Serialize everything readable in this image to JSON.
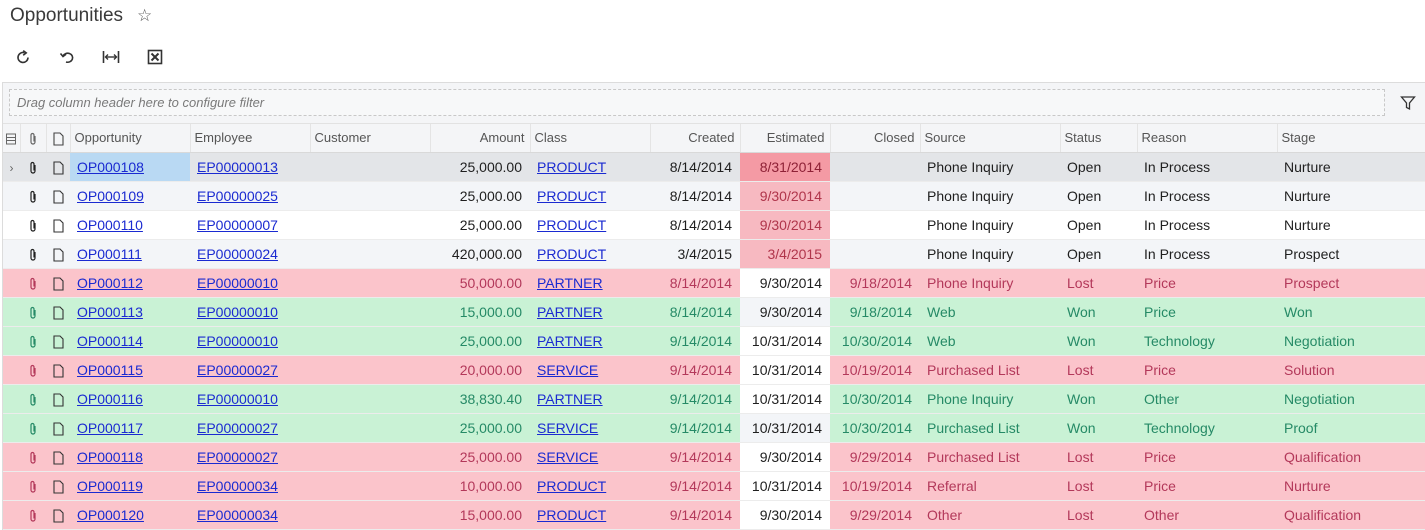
{
  "page": {
    "title": "Opportunities",
    "favorite_icon": "star-outline-icon"
  },
  "toolbar": {
    "buttons": [
      {
        "name": "refresh-button",
        "icon": "refresh-icon"
      },
      {
        "name": "undo-button",
        "icon": "undo-icon"
      },
      {
        "name": "fit-columns-button",
        "icon": "fit-columns-icon"
      },
      {
        "name": "export-excel-button",
        "icon": "excel-icon"
      }
    ]
  },
  "filter": {
    "placeholder": "Drag column header here to configure filter",
    "icon": "filter-funnel-icon"
  },
  "columns": {
    "opportunity": "Opportunity",
    "employee": "Employee",
    "customer": "Customer",
    "amount": "Amount",
    "class": "Class",
    "created": "Created",
    "estimated": "Estimated",
    "closed": "Closed",
    "source": "Source",
    "status": "Status",
    "reason": "Reason",
    "stage": "Stage"
  },
  "colors": {
    "lost_row": "#fbc4cb",
    "won_row": "#c9f2d5",
    "overdue_estimate": "#f7b9c1",
    "selected_cell": "#b9d9f3",
    "link": "#1a2ad1"
  },
  "rows": [
    {
      "opportunity": "OP000108",
      "employee": "EP00000013",
      "customer": "",
      "amount": "25,000.00",
      "class": "PRODUCT",
      "created": "8/14/2014",
      "estimated": "8/31/2014",
      "closed": "",
      "source": "Phone Inquiry",
      "status": "Open",
      "reason": "In Process",
      "stage": "Nurture"
    },
    {
      "opportunity": "OP000109",
      "employee": "EP00000025",
      "customer": "",
      "amount": "25,000.00",
      "class": "PRODUCT",
      "created": "8/14/2014",
      "estimated": "9/30/2014",
      "closed": "",
      "source": "Phone Inquiry",
      "status": "Open",
      "reason": "In Process",
      "stage": "Nurture"
    },
    {
      "opportunity": "OP000110",
      "employee": "EP00000007",
      "customer": "",
      "amount": "25,000.00",
      "class": "PRODUCT",
      "created": "8/14/2014",
      "estimated": "9/30/2014",
      "closed": "",
      "source": "Phone Inquiry",
      "status": "Open",
      "reason": "In Process",
      "stage": "Nurture"
    },
    {
      "opportunity": "OP000111",
      "employee": "EP00000024",
      "customer": "",
      "amount": "420,000.00",
      "class": "PRODUCT",
      "created": "3/4/2015",
      "estimated": "3/4/2015",
      "closed": "",
      "source": "Phone Inquiry",
      "status": "Open",
      "reason": "In Process",
      "stage": "Prospect"
    },
    {
      "opportunity": "OP000112",
      "employee": "EP00000010",
      "customer": "",
      "amount": "50,000.00",
      "class": "PARTNER",
      "created": "8/14/2014",
      "estimated": "9/30/2014",
      "closed": "9/18/2014",
      "source": "Phone Inquiry",
      "status": "Lost",
      "reason": "Price",
      "stage": "Prospect"
    },
    {
      "opportunity": "OP000113",
      "employee": "EP00000010",
      "customer": "",
      "amount": "15,000.00",
      "class": "PARTNER",
      "created": "8/14/2014",
      "estimated": "9/30/2014",
      "closed": "9/18/2014",
      "source": "Web",
      "status": "Won",
      "reason": "Price",
      "stage": "Won"
    },
    {
      "opportunity": "OP000114",
      "employee": "EP00000010",
      "customer": "",
      "amount": "25,000.00",
      "class": "PARTNER",
      "created": "9/14/2014",
      "estimated": "10/31/2014",
      "closed": "10/30/2014",
      "source": "Web",
      "status": "Won",
      "reason": "Technology",
      "stage": "Negotiation"
    },
    {
      "opportunity": "OP000115",
      "employee": "EP00000027",
      "customer": "",
      "amount": "20,000.00",
      "class": "SERVICE",
      "created": "9/14/2014",
      "estimated": "10/31/2014",
      "closed": "10/19/2014",
      "source": "Purchased List",
      "status": "Lost",
      "reason": "Price",
      "stage": "Solution"
    },
    {
      "opportunity": "OP000116",
      "employee": "EP00000010",
      "customer": "",
      "amount": "38,830.40",
      "class": "PARTNER",
      "created": "9/14/2014",
      "estimated": "10/31/2014",
      "closed": "10/30/2014",
      "source": "Phone Inquiry",
      "status": "Won",
      "reason": "Other",
      "stage": "Negotiation"
    },
    {
      "opportunity": "OP000117",
      "employee": "EP00000027",
      "customer": "",
      "amount": "25,000.00",
      "class": "SERVICE",
      "created": "9/14/2014",
      "estimated": "10/31/2014",
      "closed": "10/30/2014",
      "source": "Purchased List",
      "status": "Won",
      "reason": "Technology",
      "stage": "Proof"
    },
    {
      "opportunity": "OP000118",
      "employee": "EP00000027",
      "customer": "",
      "amount": "25,000.00",
      "class": "SERVICE",
      "created": "9/14/2014",
      "estimated": "9/30/2014",
      "closed": "9/29/2014",
      "source": "Purchased List",
      "status": "Lost",
      "reason": "Price",
      "stage": "Qualification"
    },
    {
      "opportunity": "OP000119",
      "employee": "EP00000034",
      "customer": "",
      "amount": "10,000.00",
      "class": "PRODUCT",
      "created": "9/14/2014",
      "estimated": "10/31/2014",
      "closed": "10/19/2014",
      "source": "Referral",
      "status": "Lost",
      "reason": "Price",
      "stage": "Nurture"
    },
    {
      "opportunity": "OP000120",
      "employee": "EP00000034",
      "customer": "",
      "amount": "15,000.00",
      "class": "PRODUCT",
      "created": "9/14/2014",
      "estimated": "9/30/2014",
      "closed": "9/29/2014",
      "source": "Other",
      "status": "Lost",
      "reason": "Other",
      "stage": "Qualification"
    }
  ]
}
